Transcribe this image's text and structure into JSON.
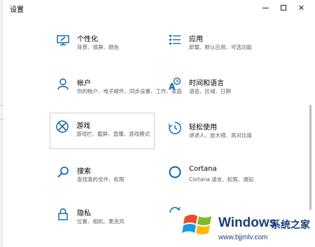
{
  "window": {
    "title": "设置"
  },
  "tiles": [
    {
      "label": "个性化",
      "desc": "背景、锁屏、颜色",
      "icon": "personalization-icon"
    },
    {
      "label": "应用",
      "desc": "卸载、默认应用、可选功能",
      "icon": "apps-icon"
    },
    {
      "label": "帐户",
      "desc": "你的帐户、电子邮件、同步设置、工作、家庭",
      "icon": "account-icon"
    },
    {
      "label": "时间和语言",
      "desc": "语音、区域、日期",
      "icon": "time-language-icon"
    },
    {
      "label": "游戏",
      "desc": "游戏栏、截屏、直播、游戏模式",
      "icon": "xbox-icon"
    },
    {
      "label": "轻松使用",
      "desc": "讲述人、放大镜、高对比度",
      "icon": "ease-of-access-icon"
    },
    {
      "label": "搜索",
      "desc": "查找我的文件、权限",
      "icon": "search-icon"
    },
    {
      "label": "Cortana",
      "desc": "Cortana 语言、权限、通知",
      "icon": "cortana-icon"
    },
    {
      "label": "隐私",
      "desc": "位置、相机、麦克风",
      "icon": "lock-icon"
    }
  ],
  "watermark": {
    "brand": "Windows",
    "brand_cn": "系统之家",
    "url": "www.bjjmlv.com"
  },
  "colors": {
    "accent": "#0063b1",
    "watermark": "#1b3e7c"
  }
}
